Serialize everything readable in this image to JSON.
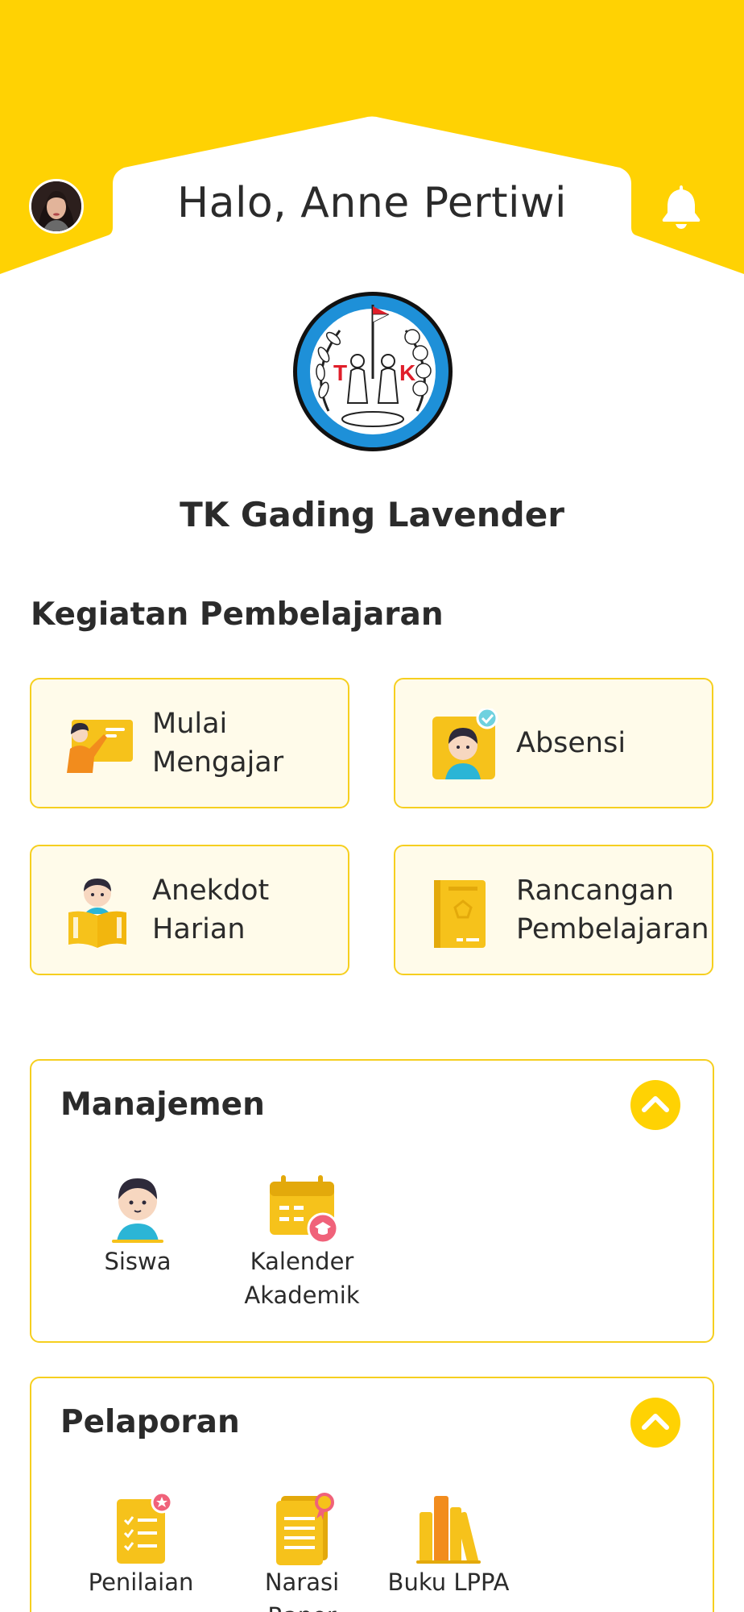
{
  "header": {
    "greeting": "Halo, Anne Pertiwi",
    "brand_color": "#FFD203"
  },
  "school": {
    "name": "TK Gading Lavender",
    "logo_letters": [
      "T",
      "K"
    ]
  },
  "kegiatan": {
    "title": "Kegiatan Pembelajaran",
    "cards": [
      {
        "label": "Mulai\nMengajar",
        "icon": "teacher-board-icon"
      },
      {
        "label": "Absensi",
        "icon": "attendance-check-icon"
      },
      {
        "label": "Anekdot\nHarian",
        "icon": "child-reading-icon"
      },
      {
        "label": "Rancangan\nPembelajaran",
        "icon": "book-icon"
      }
    ]
  },
  "manajemen": {
    "title": "Manajemen",
    "items": [
      {
        "label": "Siswa",
        "icon": "student-icon"
      },
      {
        "label": "Kalender\nAkademik",
        "icon": "calendar-icon"
      }
    ]
  },
  "pelaporan": {
    "title": "Pelaporan",
    "items": [
      {
        "label": "Penilaian",
        "icon": "assessment-icon"
      },
      {
        "label": "Narasi Rapor",
        "icon": "report-narrative-icon"
      },
      {
        "label": "Buku LPPA",
        "icon": "books-icon"
      }
    ]
  }
}
